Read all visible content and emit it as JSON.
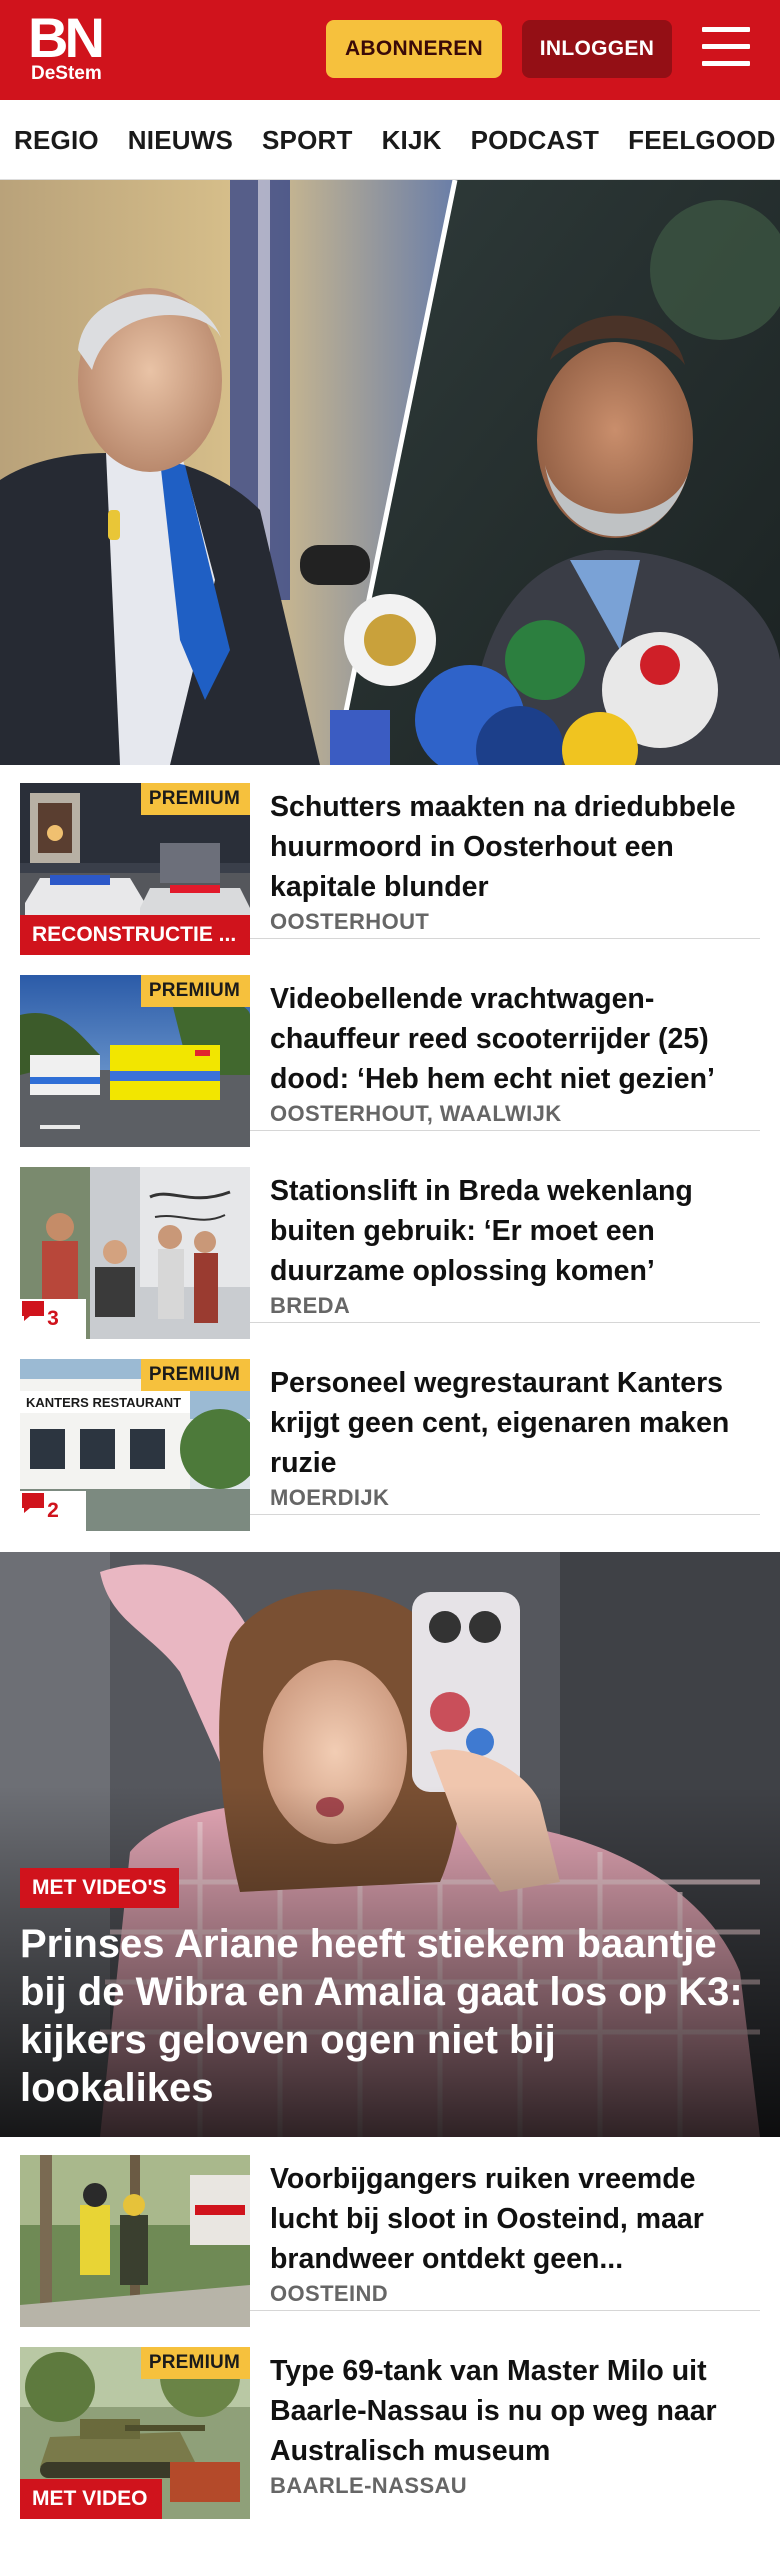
{
  "header": {
    "logo_main": "BN",
    "logo_sub": "DeStem",
    "subscribe_label": "ABONNEREN",
    "login_label": "INLOGGEN"
  },
  "nav": {
    "items": [
      "REGIO",
      "NIEUWS",
      "SPORT",
      "KIJK",
      "PODCAST",
      "FEELGOOD"
    ]
  },
  "colors": {
    "brand_red": "#d0131c",
    "dark_red": "#940f15",
    "accent_yellow": "#f6c13d"
  },
  "articles": [
    {
      "title": "Schutters maakten na driedubbele huurmoord in Oosterhout een kapitale blunder",
      "location": "OOSTERHOUT",
      "premium": "PREMIUM",
      "label": "RECONSTRUCTIE ..."
    },
    {
      "title": "Videobellende vrachtwagen­chauffeur reed scooterrijder (25) dood: ‘Heb hem echt niet gezien’",
      "location": "OOSTERHOUT, WAALWIJK",
      "premium": "PREMIUM"
    },
    {
      "title": "Stationslift in Breda wekenlang buiten gebruik: ‘Er moet een duurzame oplossing komen’",
      "location": "BREDA",
      "comments": "3",
      "icon": "comment-icon"
    },
    {
      "title": "Personeel wegrestaurant Kanters krijgt geen cent, eigenaren maken ruzie",
      "location": "MOERDIJK",
      "premium": "PREMIUM",
      "comments": "2",
      "icon": "comment-icon"
    }
  ],
  "feature": {
    "label": "MET VIDEO'S",
    "title": "Prinses Ariane heeft stiekem baantje bij de Wibra en Amalia gaat los op K3: kijkers geloven ogen niet bij lookalikes"
  },
  "articles_bottom": [
    {
      "title": "Voorbijgangers ruiken vreemde lucht bij sloot in Oosteind, maar brandweer ontdekt geen...",
      "location": "OOSTEIND"
    },
    {
      "title": "Type 69-tank van Master Milo uit Baarle-Nassau is nu op weg naar Australisch museum",
      "location": "BAARLE-NASSAU",
      "premium": "PREMIUM",
      "label": "MET VIDEO"
    }
  ],
  "thumb_text": {
    "restaurant_sign": "KANTERS RESTAURANT"
  }
}
